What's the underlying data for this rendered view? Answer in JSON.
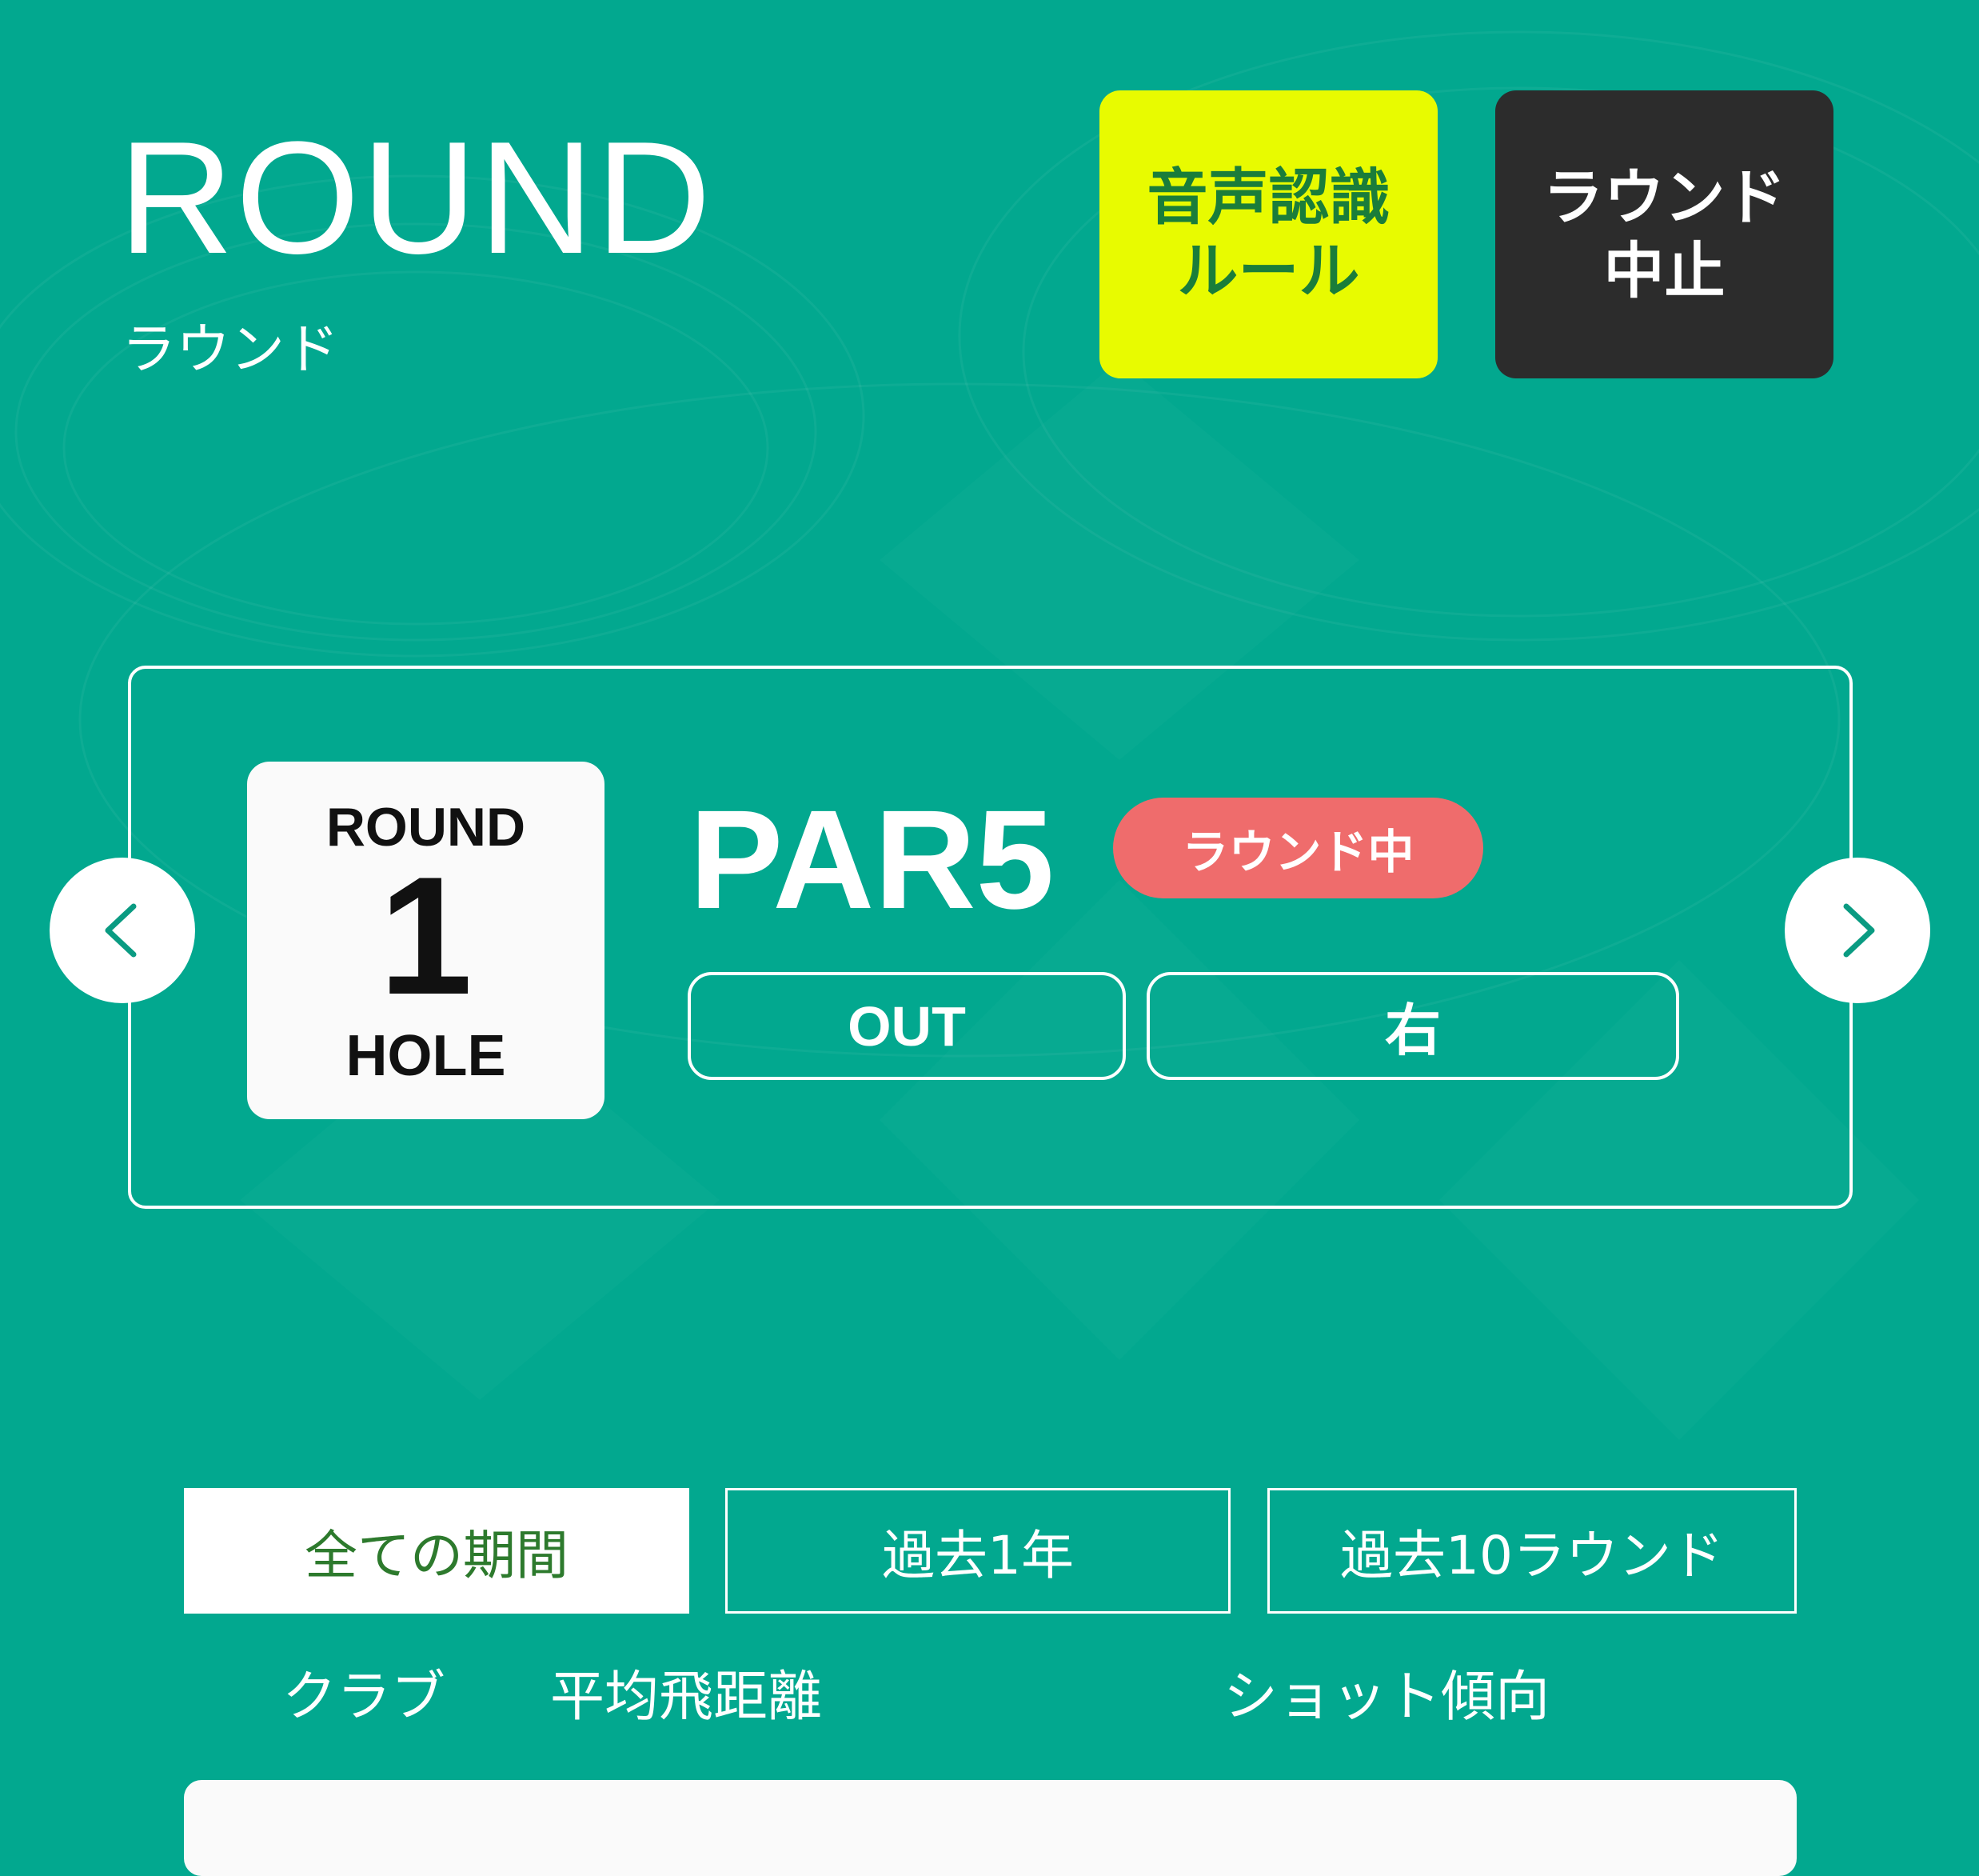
{
  "colors": {
    "background": "#02a88f",
    "voice_rule_bg": "#e8fb00",
    "voice_rule_text": "#1a7d3a",
    "stop_bg": "#2c2c2c",
    "status_badge_bg": "#ef6c6c",
    "active_tab_text": "#2d7a2d"
  },
  "header": {
    "title": "ROUND",
    "subtitle": "ラウンド"
  },
  "actions": {
    "voice_rule_label": "音声認識\nルール",
    "stop_round_label": "ラウンド\n中止"
  },
  "hole": {
    "round_label": "ROUND",
    "number": "1",
    "unit_label": "HOLE",
    "par": "PAR5",
    "status": "ラウンド中",
    "course_side": "OUT",
    "direction": "右",
    "prev_icon": "chevron-left-icon",
    "next_icon": "chevron-right-icon"
  },
  "period_tabs": [
    {
      "label": "全ての期間",
      "active": true
    },
    {
      "label": "過去1年",
      "active": false
    },
    {
      "label": "過去10ラウンド",
      "active": false
    }
  ],
  "table_header": {
    "club": "クラブ",
    "avg_distance": "平均飛距離",
    "shot_tendency": "ショット傾向"
  }
}
